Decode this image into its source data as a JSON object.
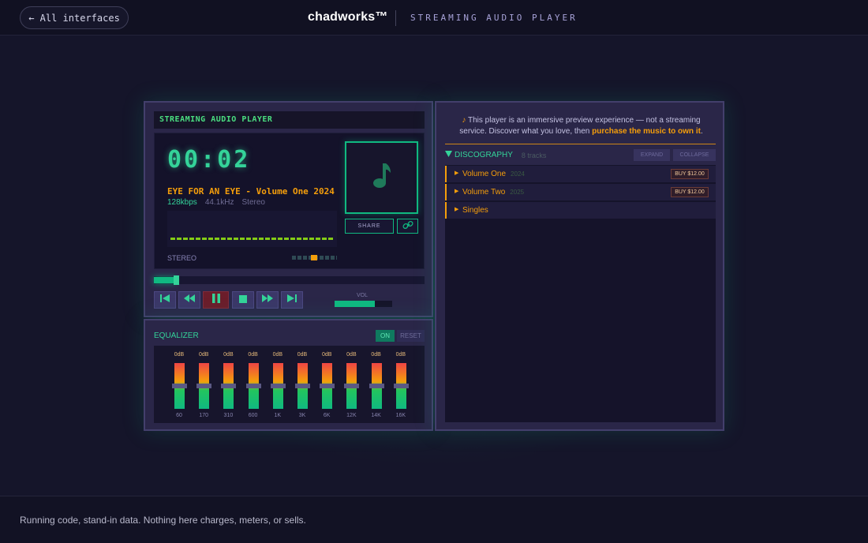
{
  "topbar": {
    "back_label": "← All interfaces",
    "brand": "chadworks™",
    "subtitle": "STREAMING AUDIO PLAYER"
  },
  "player": {
    "title": "STREAMING AUDIO PLAYER",
    "time": "00:02",
    "track": "EYE FOR AN EYE - Volume One 2024",
    "bitrate": "128kbps",
    "samplerate": "44.1kHz",
    "channels": "Stereo",
    "mode_label": "STEREO",
    "share_label": "SHARE",
    "progress": 0.08,
    "volume_label": "VOL",
    "volume": 0.7,
    "controls": [
      "previous-icon",
      "rewind-icon",
      "pause-icon",
      "stop-icon",
      "fast-forward-icon",
      "next-icon"
    ]
  },
  "equalizer": {
    "title": "EQUALIZER",
    "on_label": "ON",
    "reset_label": "RESET",
    "bands": [
      {
        "freq": "60",
        "gain": "0dB"
      },
      {
        "freq": "170",
        "gain": "0dB"
      },
      {
        "freq": "310",
        "gain": "0dB"
      },
      {
        "freq": "600",
        "gain": "0dB"
      },
      {
        "freq": "1K",
        "gain": "0dB"
      },
      {
        "freq": "3K",
        "gain": "0dB"
      },
      {
        "freq": "6K",
        "gain": "0dB"
      },
      {
        "freq": "12K",
        "gain": "0dB"
      },
      {
        "freq": "14K",
        "gain": "0dB"
      },
      {
        "freq": "16K",
        "gain": "0dB"
      }
    ]
  },
  "discography": {
    "notice_prefix": "♪",
    "notice_text": "This player is an immersive preview experience — not a streaming service. Discover what you love, then",
    "notice_cta": "purchase the music to own it",
    "notice_end": ".",
    "title": "DISCOGRAPHY",
    "count": "8 tracks",
    "expand_label": "EXPAND",
    "collapse_label": "COLLAPSE",
    "items": [
      {
        "name": "Volume One",
        "year": "2024",
        "buy": "BUY $12.00"
      },
      {
        "name": "Volume Two",
        "year": "2025",
        "buy": "BUY $12.00"
      },
      {
        "name": "Singles",
        "year": "",
        "buy": ""
      }
    ]
  },
  "footer": {
    "text": "Running code, stand-in data. Nothing here charges, meters, or sells."
  },
  "colors": {
    "accent": "#10b981",
    "amber": "#f59e0b",
    "panel": "#2a2648",
    "background": "#15152a"
  }
}
